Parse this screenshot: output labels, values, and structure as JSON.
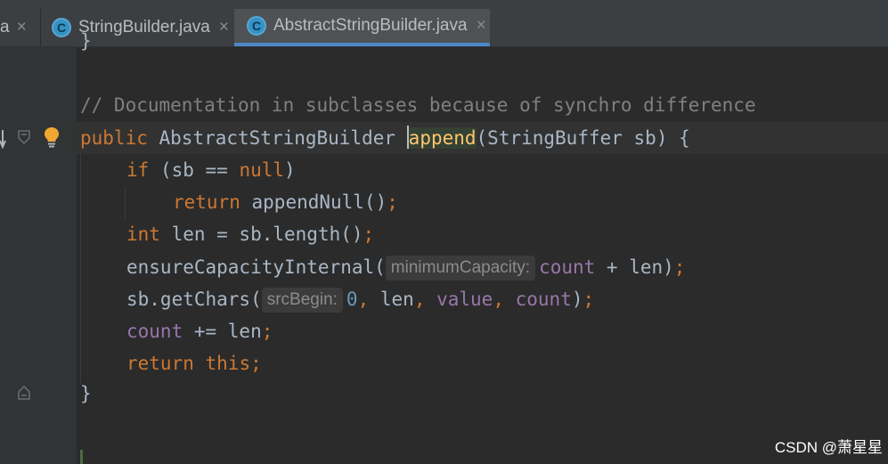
{
  "tabs": [
    {
      "label": "a",
      "active": false
    },
    {
      "label": "StringBuilder.java",
      "active": false
    },
    {
      "label": "AbstractStringBuilder.java",
      "active": true
    }
  ],
  "icons": {
    "class_icon_letter": "C",
    "close": "×"
  },
  "code": {
    "line_top": "}",
    "comment": "// Documentation in subclasses because of synchro difference",
    "sig_public": "public ",
    "sig_type": "AbstractStringBuilder ",
    "sig_method": "append",
    "sig_params": "(StringBuffer sb) {",
    "if_kw": "if ",
    "if_open": "(sb == ",
    "if_null": "null",
    "if_close": ")",
    "return_kw": "return ",
    "return_call": "appendNull()",
    "int_kw": "int ",
    "len_decl": "len = sb.length()",
    "ensure_call": "ensureCapacityInternal(",
    "hint_min": "minimumCapacity:",
    "count1": "count",
    "ensure_rest": " + len)",
    "getchars_call": "sb.getChars(",
    "hint_src": "srcBegin:",
    "zero": "0",
    "comma": ", ",
    "len": "len",
    "value": "value",
    "count2": "count",
    "close_paren": ")",
    "count3": "count",
    "plus_eq": " += len",
    "return_this_kw": "return ",
    "this_kw": "this",
    "semi": ";",
    "closing_brace": "}"
  },
  "watermark": "CSDN @萧星星"
}
